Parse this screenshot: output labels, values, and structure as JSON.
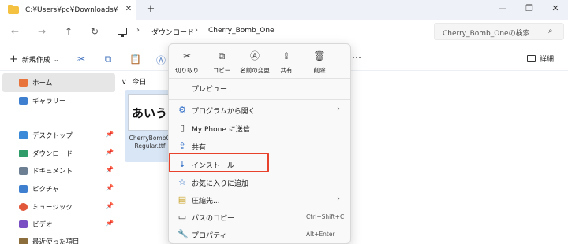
{
  "tab": {
    "title": "C:¥Users¥pc¥Downloads¥Cherr",
    "close": "✕",
    "new_tab": "+"
  },
  "window_controls": {
    "minimize": "—",
    "maximize": "❐",
    "close": "✕"
  },
  "nav": {
    "back": "←",
    "forward": "→",
    "up": "↑",
    "refresh": "↻",
    "crumb_sep": "›",
    "crumbs": [
      "ダウンロード",
      "Cherry_Bomb_One"
    ],
    "search_placeholder": "Cherry_Bomb_Oneの検索",
    "search_icon": "⌕"
  },
  "commandbar": {
    "new_label": "新規作成",
    "new_plus": "+",
    "new_chevron": "⌄",
    "icons": {
      "cut": "✂",
      "copy": "⧉",
      "paste": "📋",
      "rename": "Ⓐ"
    },
    "more": "⋯",
    "details_label": "詳細"
  },
  "sidebar": {
    "items": [
      {
        "label": "ホーム",
        "icon": "home-icon",
        "color": "#e8743b"
      },
      {
        "label": "ギャラリー",
        "icon": "gallery-icon",
        "color": "#3f7fd0"
      },
      {
        "label": "デスクトップ",
        "icon": "desktop-icon",
        "color": "#3a8ad9"
      },
      {
        "label": "ダウンロード",
        "icon": "download-icon",
        "color": "#2f9c6a"
      },
      {
        "label": "ドキュメント",
        "icon": "document-icon",
        "color": "#6d7f93"
      },
      {
        "label": "ピクチャ",
        "icon": "pictures-icon",
        "color": "#3f7fd0"
      },
      {
        "label": "ミュージック",
        "icon": "music-icon",
        "color": "#e0573a"
      },
      {
        "label": "ビデオ",
        "icon": "video-icon",
        "color": "#7a4fc4"
      },
      {
        "label": "最近使った項目",
        "icon": "recent-icon",
        "color": "#8c6d3c"
      }
    ],
    "pin": "📌"
  },
  "content": {
    "group_chevron": "∨",
    "group_label": "今日",
    "file": {
      "thumb_text": "あいう",
      "name_line1": "CherryBombO",
      "name_line2": "Regular.ttf"
    }
  },
  "context_menu": {
    "quick_actions": [
      {
        "label": "切り取り",
        "icon": "✂"
      },
      {
        "label": "コピー",
        "icon": "⧉"
      },
      {
        "label": "名前の変更",
        "icon": "Ⓐ"
      },
      {
        "label": "共有",
        "icon": "⇪"
      },
      {
        "label": "削除",
        "icon": "🗑"
      }
    ],
    "items": [
      {
        "label": "プレビュー",
        "icon": "",
        "shortcut": "",
        "arrow": ""
      },
      {
        "label": "プログラムから開く",
        "icon": "⚙",
        "shortcut": "",
        "arrow": "›"
      },
      {
        "label": "My Phone に送信",
        "icon": "▯",
        "shortcut": "",
        "arrow": ""
      },
      {
        "label": "共有",
        "icon": "⇪",
        "shortcut": "",
        "arrow": ""
      },
      {
        "label": "インストール",
        "icon": "↓",
        "shortcut": "",
        "arrow": ""
      },
      {
        "label": "お気に入りに追加",
        "icon": "☆",
        "shortcut": "",
        "arrow": ""
      },
      {
        "label": "圧縮先...",
        "icon": "▤",
        "shortcut": "",
        "arrow": "›"
      },
      {
        "label": "パスのコピー",
        "icon": "▭",
        "shortcut": "Ctrl+Shift+C",
        "arrow": ""
      },
      {
        "label": "プロパティ",
        "icon": "🔧",
        "shortcut": "Alt+Enter",
        "arrow": ""
      }
    ]
  },
  "colors": {
    "highlight": "#e8412c",
    "selection": "#d9e6f6",
    "accent": "#2d6cc7"
  }
}
